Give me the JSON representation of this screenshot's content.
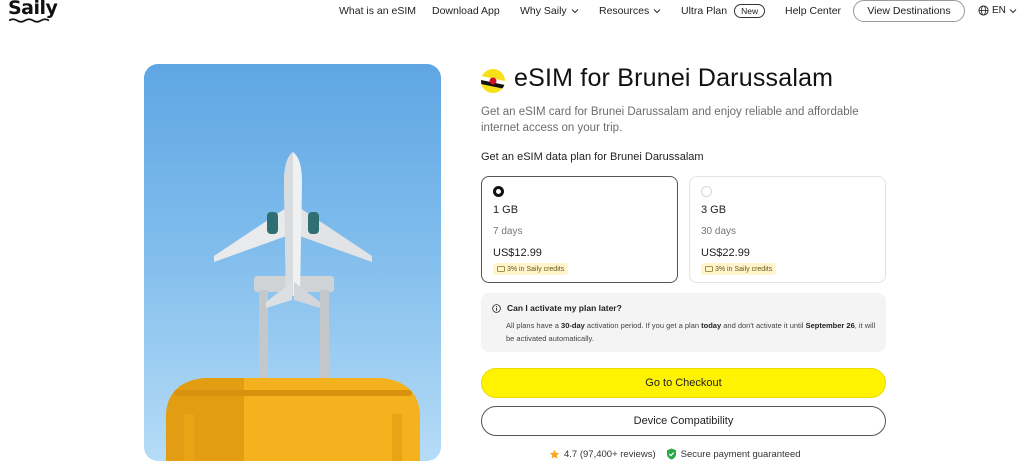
{
  "brand": {
    "logo_text": "Saily"
  },
  "nav": {
    "items": [
      {
        "label": "What is an eSIM"
      },
      {
        "label": "Download App"
      },
      {
        "label": "Why Saily"
      },
      {
        "label": "Resources"
      },
      {
        "label": "Ultra Plan"
      },
      {
        "label": "Help Center"
      }
    ],
    "new_badge": "New",
    "view_destinations": "View Destinations",
    "language": "EN"
  },
  "product": {
    "title": "eSIM for Brunei Darussalam",
    "subtitle": "Get an eSIM card for Brunei Darussalam and enjoy reliable and affordable internet access on your trip.",
    "section_title": "Get an eSIM data plan for Brunei Darussalam",
    "plans": [
      {
        "size": "1 GB",
        "days": "7 days",
        "price": "US$12.99",
        "credit": "3% in Saily credits",
        "selected": true
      },
      {
        "size": "3 GB",
        "days": "30 days",
        "price": "US$22.99",
        "credit": "3% in Saily credits",
        "selected": false
      }
    ]
  },
  "info": {
    "question": "Can I activate my plan later?",
    "a1": "All plans have a ",
    "a2": "30-day",
    "a3": " activation period. If you get a plan ",
    "a4": "today",
    "a5": " and don't activate it until ",
    "a6": "September 26",
    "a7": ", it will be activated automatically."
  },
  "actions": {
    "checkout": "Go to Checkout",
    "compatibility": "Device Compatibility"
  },
  "trust": {
    "rating": "4.7 (97,400+ reviews)",
    "secure": "Secure payment guaranteed"
  },
  "colors": {
    "checkout_bg": "#fff300",
    "credit_bg": "#fff4cc",
    "shield": "#27a845",
    "star": "#f5a623",
    "suitcase": "#f3b21e"
  }
}
